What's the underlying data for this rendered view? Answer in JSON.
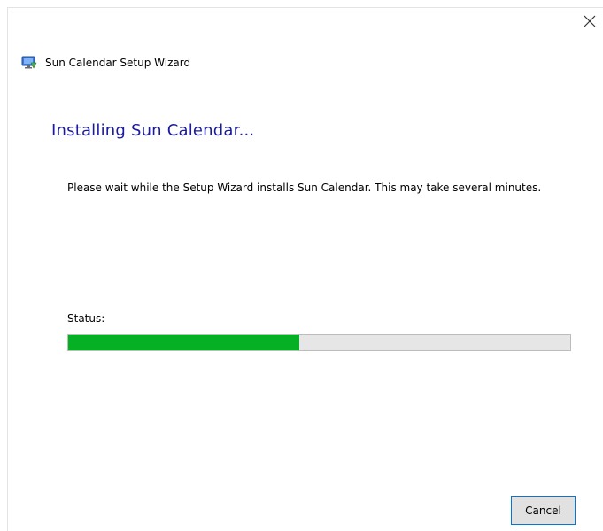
{
  "window": {
    "title": "Sun Calendar Setup Wizard",
    "close_icon": "close-icon",
    "app_icon": "installer-monitor-icon"
  },
  "main": {
    "heading": "Installing Sun Calendar...",
    "description": "Please wait while the Setup Wizard installs Sun Calendar.  This may take several minutes.",
    "status_label": "Status:",
    "progress_fraction": 0.46,
    "progress_color": "#06b025",
    "track_color": "#e6e6e6",
    "heading_color": "#1a1a9f"
  },
  "footer": {
    "cancel_label": "Cancel",
    "accent_color": "#0078d7"
  }
}
